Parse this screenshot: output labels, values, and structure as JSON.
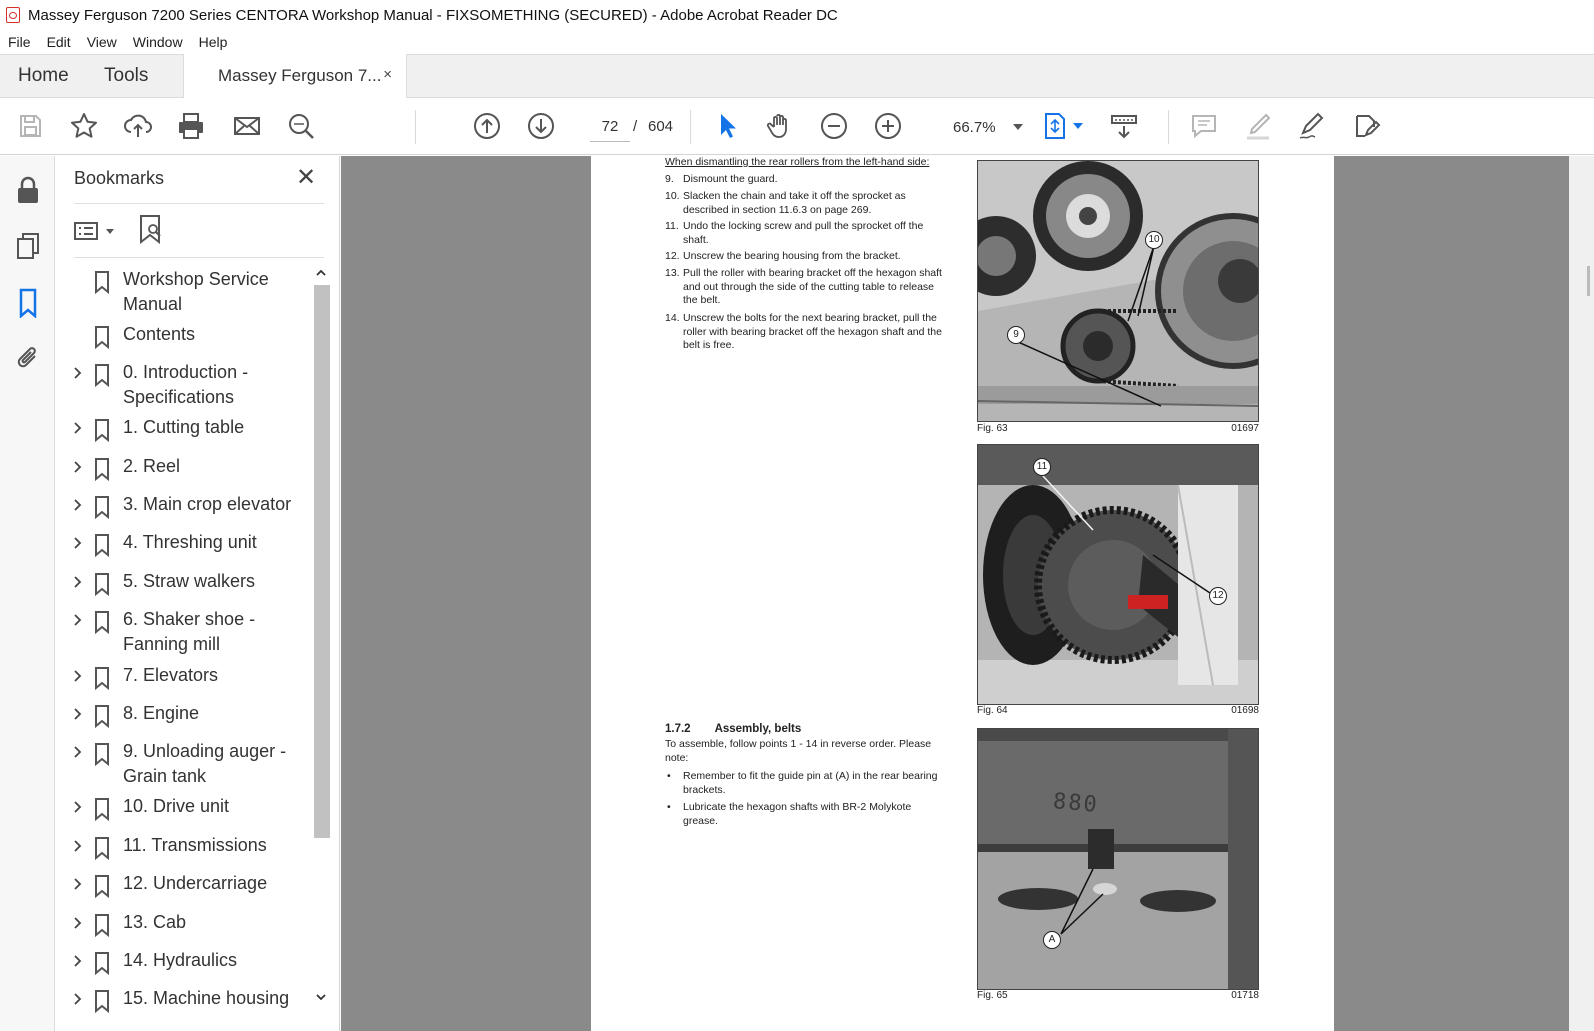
{
  "window": {
    "title": "Massey Ferguson 7200 Series CENTORA Workshop Manual - FIXSOMETHING (SECURED) - Adobe Acrobat Reader DC"
  },
  "menu": [
    "File",
    "Edit",
    "View",
    "Window",
    "Help"
  ],
  "tabs": {
    "home": "Home",
    "tools": "Tools",
    "document": "Massey Ferguson 7...",
    "close": "×"
  },
  "toolbar": {
    "current_page": "72",
    "separator": "/",
    "total_pages": "604",
    "zoom": "66.7%",
    "icons": [
      "save-icon",
      "star-icon",
      "upload-icon",
      "print-icon",
      "mail-icon",
      "search-icon",
      "prev-page-icon",
      "next-page-icon",
      "select-cursor-icon",
      "hand-icon",
      "zoom-out-icon",
      "zoom-in-icon",
      "fit-page-icon",
      "scroll-mode-icon",
      "comment-icon",
      "highlight-icon",
      "sign-icon",
      "more-tools-icon"
    ]
  },
  "colors": {
    "accent": "#1473e6",
    "canvas": "#8a8a8a",
    "brand_red": "#d5312a"
  },
  "bookmarks": {
    "title": "Bookmarks",
    "close": "✕",
    "items": [
      {
        "label": "Workshop Service Manual",
        "expandable": false
      },
      {
        "label": "Contents",
        "expandable": false
      },
      {
        "label": "0. Introduction - Specifications",
        "expandable": true
      },
      {
        "label": "1. Cutting table",
        "expandable": true
      },
      {
        "label": "2. Reel",
        "expandable": true
      },
      {
        "label": "3. Main crop elevator",
        "expandable": true
      },
      {
        "label": "4. Threshing unit",
        "expandable": true
      },
      {
        "label": "5. Straw walkers",
        "expandable": true
      },
      {
        "label": "6. Shaker shoe - Fanning mill",
        "expandable": true
      },
      {
        "label": "7. Elevators",
        "expandable": true
      },
      {
        "label": "8. Engine",
        "expandable": true
      },
      {
        "label": "9. Unloading auger - Grain tank",
        "expandable": true
      },
      {
        "label": "10. Drive unit",
        "expandable": true
      },
      {
        "label": "11. Transmissions",
        "expandable": true
      },
      {
        "label": "12. Undercarriage",
        "expandable": true
      },
      {
        "label": "13. Cab",
        "expandable": true
      },
      {
        "label": "14. Hydraulics",
        "expandable": true
      },
      {
        "label": "15. Machine housing",
        "expandable": true
      }
    ]
  },
  "document": {
    "intro": "When dismantling the rear rollers from the left-hand side:",
    "steps": [
      {
        "n": "9.",
        "text": "Dismount the guard."
      },
      {
        "n": "10.",
        "text": "Slacken the chain and take it off the sprocket as described in section 11.6.3 on page 269."
      },
      {
        "n": "11.",
        "text": "Undo the locking screw and pull the sprocket off the shaft."
      },
      {
        "n": "12.",
        "text": "Unscrew the bearing housing from the bracket."
      },
      {
        "n": "13.",
        "text": "Pull the roller with bearing bracket off the hexagon shaft and out through the side of the cutting table to release the belt."
      },
      {
        "n": "14.",
        "text": "Unscrew the bolts for the next bearing bracket, pull the roller with bearing bracket off the hexagon shaft and the belt is free."
      }
    ],
    "section_number": "1.7.2",
    "section_title": "Assembly, belts",
    "section_intro": "To assemble, follow points 1 - 14 in reverse order. Please note:",
    "bullets": [
      "Remember to fit the guide pin at (A) in the rear bearing brackets.",
      "Lubricate the hexagon shafts with BR-2 Molykote grease."
    ],
    "figures": [
      {
        "caption": "Fig. 63",
        "code": "01697",
        "callouts": [
          "10",
          "9"
        ]
      },
      {
        "caption": "Fig. 64",
        "code": "01698",
        "callouts": [
          "11",
          "12"
        ]
      },
      {
        "caption": "Fig. 65",
        "code": "01718",
        "callouts": [
          "A"
        ],
        "stamp": "880"
      }
    ]
  }
}
